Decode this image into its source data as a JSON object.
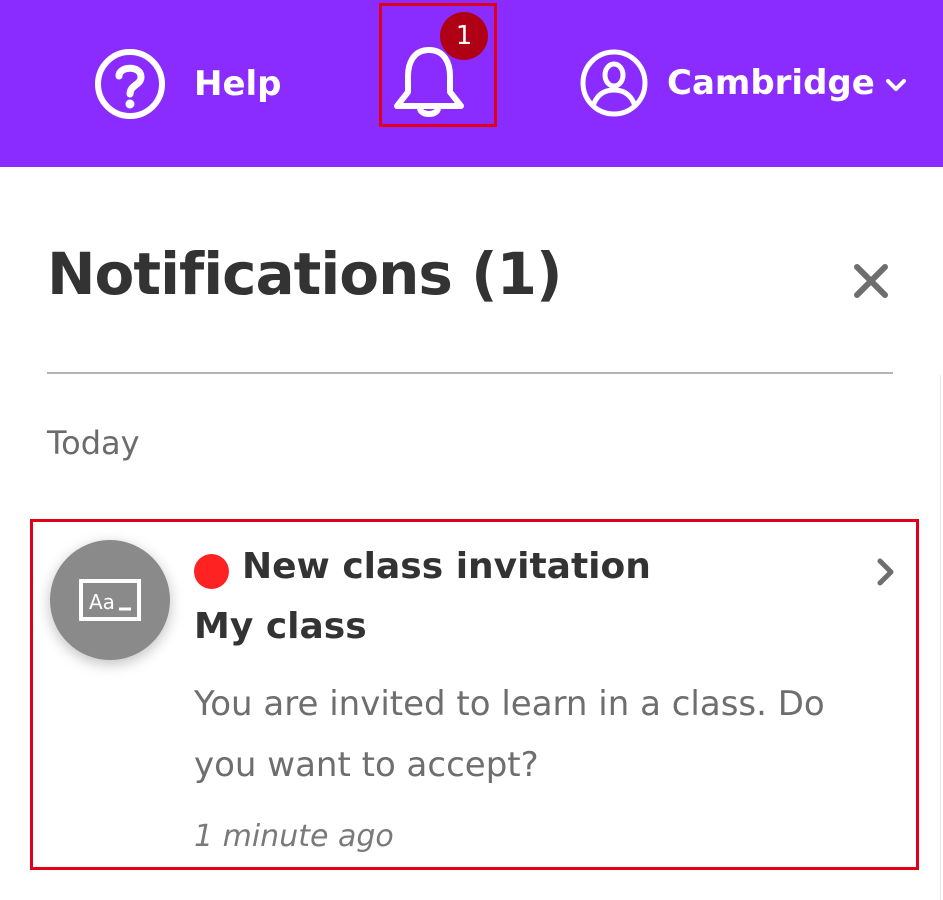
{
  "header": {
    "help_label": "Help",
    "notification_count": "1",
    "account_label": "Cambridge",
    "background_color": "#8a2bff",
    "icons": [
      "help-circle-icon",
      "bell-icon",
      "user-circle-icon",
      "chevron-down-icon"
    ]
  },
  "panel": {
    "title": "Notifications (1)",
    "close_icon": "close-icon",
    "group_label": "Today"
  },
  "notifications": [
    {
      "title": "New class invitation",
      "subtitle": "My class",
      "body": "You are invited to learn in a class. Do you want to accept?",
      "time": "1 minute ago",
      "unread": true,
      "unread_color": "#ff2222",
      "avatar_icon": "text-class-icon",
      "chevron_icon": "chevron-right-icon"
    }
  ],
  "highlight_color": "#e1001a"
}
